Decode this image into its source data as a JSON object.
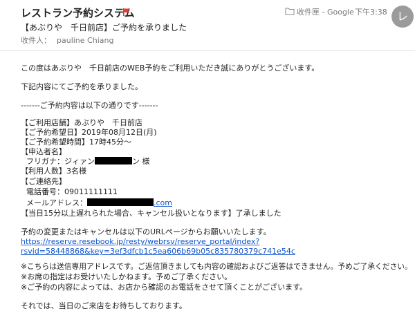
{
  "header": {
    "subject": "レストラン予約システム",
    "folder_label": "收件匣 - Google",
    "time": "下午3:38",
    "avatar_initial": "レ",
    "shop_line": "【あぶりや　千日前店】ご予約を承りました",
    "recipient_label": "收件人：",
    "recipient_name": "pauline Chiang"
  },
  "body": {
    "greeting": "この度はあぶりや　千日前店のWEB予約をご利用いただき誠にありがとうございます。",
    "accepted": "下記内容にてご予約を承りました。",
    "divider_text": "-------ご予約内容は以下の通りです-------",
    "shop": "【ご利用店舗】あぶりや　千日前店",
    "date": "【ご予約希望日】2019年08月12日(月)",
    "time": "【ご予約希望時間】17時45分～",
    "applicant_heading": "【申込者名】",
    "furigana_prefix": "フリガナ：ジィァン",
    "furigana_suffix": "ン 様",
    "party": "【利用人数】3名様",
    "contact_heading": "【ご連絡先】",
    "phone": "電話番号：09011111111",
    "email_prefix": "メールアドレス：",
    "email_suffix": ".com",
    "late_notice": "【当日15分以上遅れられた場合、キャンセル扱いとなります】了承しました",
    "change_notice": "予約の変更またはキャンセルは以下のURLページからお願いいたします。",
    "url_line1": "https://reserve.resebook.jp/resty/webrsv/reserve_portal/index?",
    "url_line2": "rsvid=58448868&key=3ef3dfcb1c5ea606b69b05c835780379c741e54c",
    "note1": "※こちらは送信専用アドレスです。ご返信頂きましても内容の確認およびご返答はできません。予めご了承ください。",
    "note2": "※お席の指定はお受けいたしかねます。予めご了承ください。",
    "note3": "※ご予約の内容によっては、お店から確認のお電話をさせて頂くことがございます。",
    "closing": "それでは、当日のご来店をお待ちしております。"
  },
  "colors": {
    "flag": "#e03b36",
    "link": "#1155cc",
    "meta_text": "#777777",
    "avatar_bg": "#9b9b9b"
  }
}
